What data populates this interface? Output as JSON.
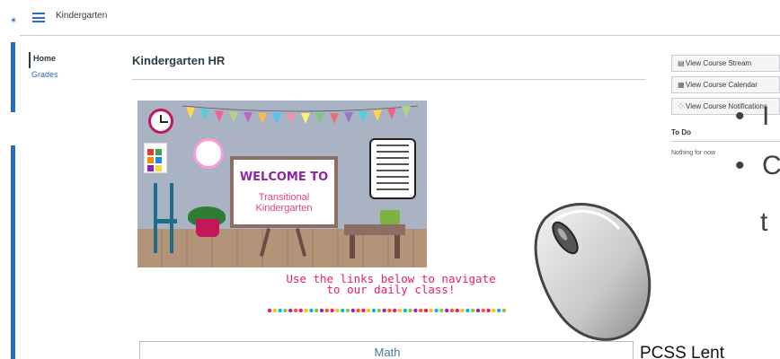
{
  "header": {
    "breadcrumb": "Kindergarten"
  },
  "course_nav": {
    "items": [
      {
        "label": "Home"
      },
      {
        "label": "Grades"
      }
    ]
  },
  "main": {
    "title": "Kindergarten HR",
    "scene": {
      "board_title": "WELCOME TO",
      "board_line1": "Transitional",
      "board_line2": "Kindergarten"
    },
    "prompt_line1": "Use the links below to navigate",
    "prompt_line2": "to our daily class!",
    "math_title": "Math"
  },
  "sidebar": {
    "buttons": [
      {
        "label": "View Course Stream",
        "icon": "stream-icon"
      },
      {
        "label": "View Course Calendar",
        "icon": "calendar-icon"
      },
      {
        "label": "View Course Notifications",
        "icon": "bell-icon"
      }
    ],
    "todo_heading": "To Do",
    "todo_empty": "Nothing for now"
  },
  "overlay": {
    "bullet1_fragment": "I",
    "bullet2_fragment": "C",
    "line2_fragment": "t",
    "bottom_fragment": "PCSS Lent"
  },
  "colors": {
    "accent": "#2a6ebb",
    "text": "#2d3b45",
    "prompt": "#e91e63"
  }
}
